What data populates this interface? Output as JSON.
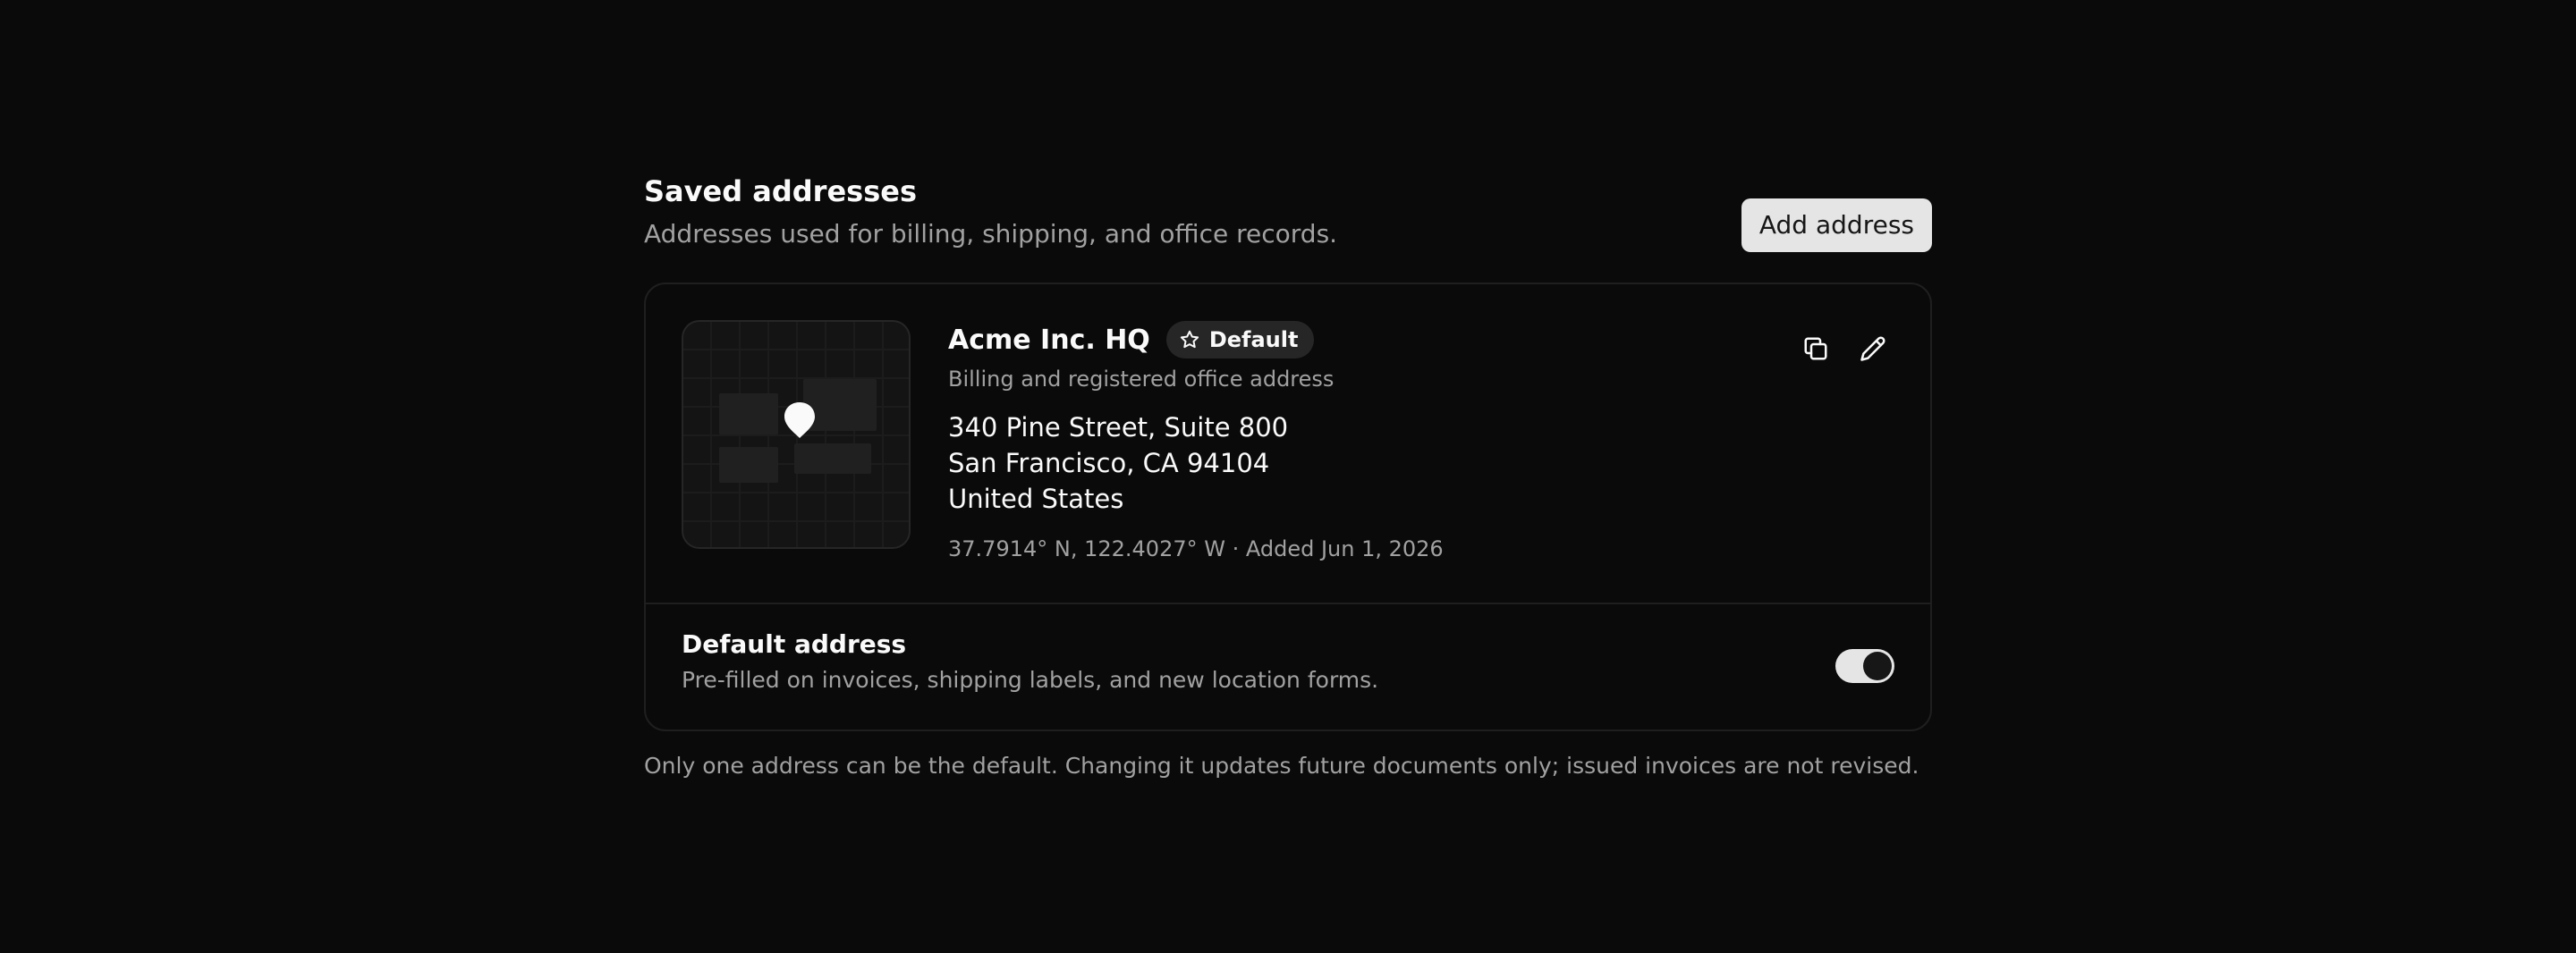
{
  "header": {
    "title": "Saved addresses",
    "subtitle": "Addresses used for billing, shipping, and office records.",
    "add_button_label": "Add address"
  },
  "address_card": {
    "name": "Acme Inc. HQ",
    "badge_label": "Default",
    "badge_icon": "star-icon",
    "description": "Billing and registered office address",
    "street": "340 Pine Street, Suite 800",
    "city_line": "San Francisco, CA 94104",
    "country": "United States",
    "meta": "37.7914° N, 122.4027° W · Added Jun 1, 2026",
    "map_icon": "map-pin-icon",
    "actions": [
      {
        "name": "copy-icon"
      },
      {
        "name": "pencil-icon"
      }
    ]
  },
  "default_setting": {
    "title": "Default address",
    "description": "Pre-filled on invoices, shipping labels, and new location forms.",
    "enabled": true
  },
  "footnote": "Only one address can be the default. Changing it updates future documents only; issued invoices are not revised.",
  "colors": {
    "background": "#0a0a0a",
    "card_border": "#1f1f1f",
    "text_primary": "#fafafa",
    "text_muted": "#a1a1a1",
    "button_bg": "#e5e5e5",
    "badge_bg": "#262626"
  }
}
